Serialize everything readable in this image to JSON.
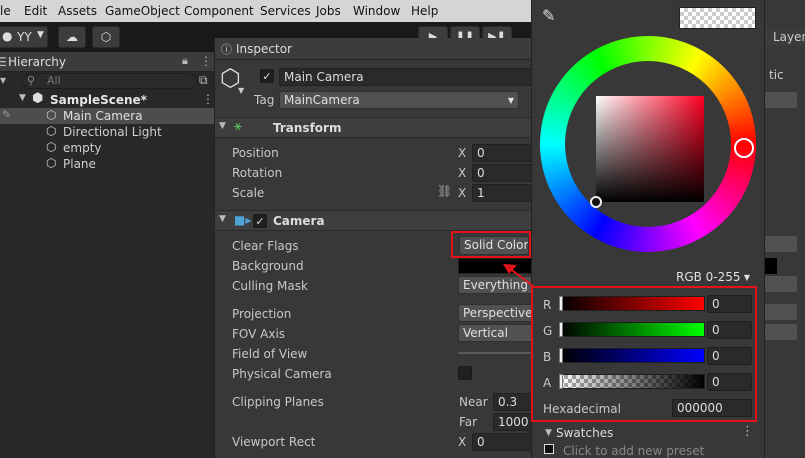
{
  "menu": [
    "le",
    "Edit",
    "Assets",
    "GameObject",
    "Component",
    "Services",
    "Jobs",
    "Window",
    "Help"
  ],
  "toolbar": {
    "account_label": "YY"
  },
  "hierarchy": {
    "tab_label": "Hierarchy",
    "search_placeholder": "All",
    "scene": "SampleScene*",
    "items": [
      "Main Camera",
      "Directional Light",
      "empty",
      "Plane"
    ]
  },
  "inspector": {
    "tab_label": "Inspector",
    "object_name": "Main Camera",
    "tag_label": "Tag",
    "tag_value": "MainCamera",
    "transform": {
      "title": "Transform",
      "rows": [
        {
          "label": "Position",
          "axis": "X",
          "value": "0"
        },
        {
          "label": "Rotation",
          "axis": "X",
          "value": "0"
        },
        {
          "label": "Scale",
          "axis": "X",
          "value": "1"
        }
      ]
    },
    "camera": {
      "title": "Camera",
      "clear_flags_label": "Clear Flags",
      "clear_flags_value": "Solid Color",
      "background_label": "Background",
      "culling_mask_label": "Culling Mask",
      "culling_mask_value": "Everything",
      "projection_label": "Projection",
      "projection_value": "Perspective",
      "fov_axis_label": "FOV Axis",
      "fov_axis_value": "Vertical",
      "fov_label": "Field of View",
      "physical_label": "Physical Camera",
      "clipping_label": "Clipping Planes",
      "near_label": "Near",
      "near_value": "0.3",
      "far_label": "Far",
      "far_value": "1000",
      "viewport_label": "Viewport Rect",
      "viewport_axis": "X",
      "viewport_value": "0"
    }
  },
  "color_picker": {
    "mode": "RGB 0-255",
    "channels": [
      {
        "label": "R",
        "value": "0",
        "color": "#ff0000"
      },
      {
        "label": "G",
        "value": "0",
        "color": "#00ff00"
      },
      {
        "label": "B",
        "value": "0",
        "color": "#0000ff"
      },
      {
        "label": "A",
        "value": "0",
        "color": "#000000"
      }
    ],
    "hex_label": "Hexadecimal",
    "hex_value": "000000",
    "swatches_label": "Swatches",
    "swatches_hint": "Click to add new preset"
  },
  "right_panel": {
    "tab_partial": "Layer",
    "dropdown_partial": "tic"
  },
  "colors": {
    "highlight": "#e2111a",
    "selection": "#4d4d4d",
    "menubar": "#d5d5d5"
  }
}
